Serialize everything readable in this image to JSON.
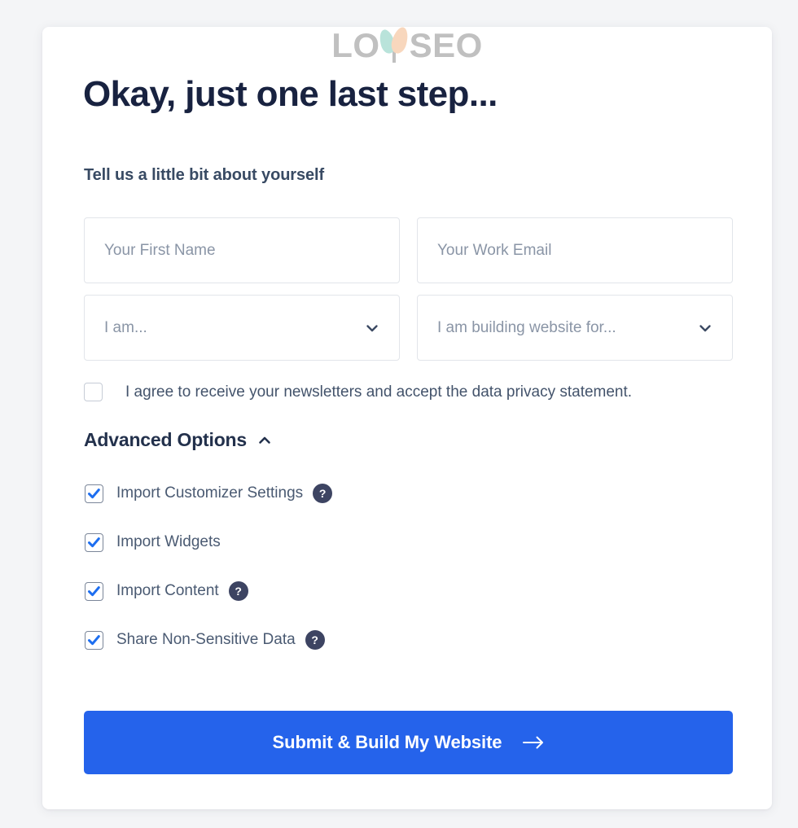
{
  "brand": {
    "name_left": "LO",
    "name_right": "SEO",
    "logo_mark": "two-leaf-plant",
    "leaf_left_color": "#8fd3c5",
    "leaf_right_color": "#f4bf96",
    "text_color": "#9a9a9a"
  },
  "heading": {
    "title": "Okay, just one last step...",
    "subtitle": "Tell us a little bit about yourself"
  },
  "form": {
    "first_name": {
      "value": "",
      "placeholder": "Your First Name"
    },
    "work_email": {
      "value": "",
      "placeholder": "Your Work Email"
    },
    "role_select": {
      "value": "I am...",
      "chevron": "chevron-down-icon"
    },
    "purpose_select": {
      "value": "I am building website for...",
      "chevron": "chevron-down-icon"
    },
    "agree": {
      "label": "I agree to receive your newsletters and accept the data privacy statement.",
      "checked": false
    }
  },
  "advanced": {
    "label": "Advanced Options",
    "expanded": true,
    "chevron": "chevron-up-icon",
    "options": [
      {
        "label": "Import Customizer Settings",
        "checked": true,
        "help": true,
        "help_glyph": "?"
      },
      {
        "label": "Import Widgets",
        "checked": true,
        "help": false,
        "help_glyph": "?"
      },
      {
        "label": "Import Content",
        "checked": true,
        "help": true,
        "help_glyph": "?"
      },
      {
        "label": "Share Non-Sensitive Data",
        "checked": true,
        "help": true,
        "help_glyph": "?"
      }
    ]
  },
  "submit": {
    "label": "Submit & Build My Website",
    "arrow_icon": "arrow-right-icon",
    "color": "#2563eb"
  },
  "colors": {
    "page_background": "#f4f5f7",
    "card_background": "#ffffff",
    "accent": "#2563eb",
    "title": "#182240",
    "help_badge": "#3d4462",
    "checkbox_check": "#1d6ef0"
  }
}
